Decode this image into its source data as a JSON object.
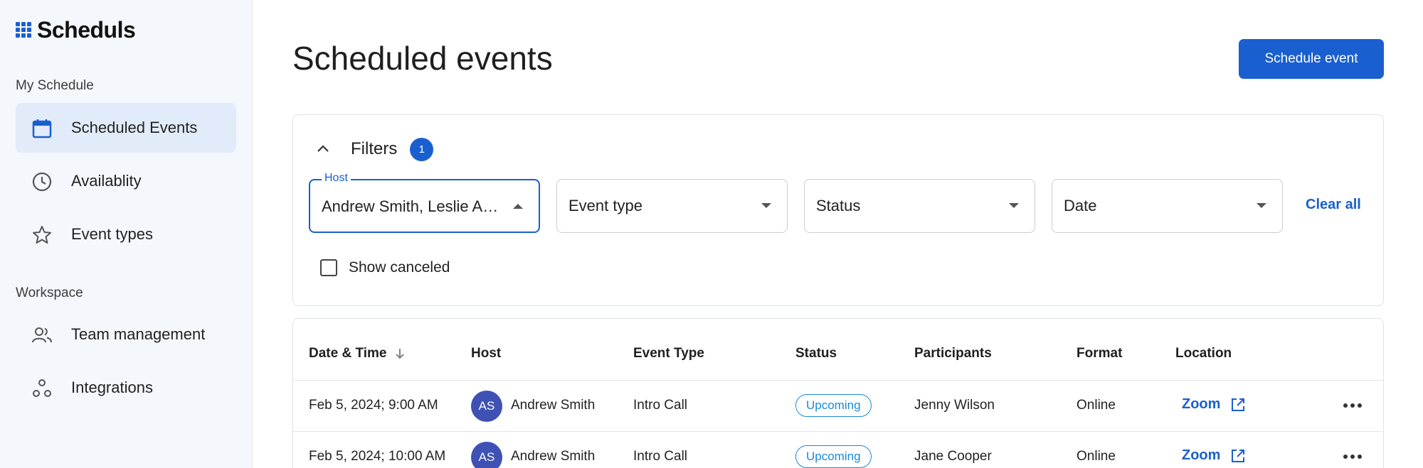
{
  "app": {
    "name": "Scheduls"
  },
  "sidebar": {
    "section_my": "My Schedule",
    "section_workspace": "Workspace",
    "items": [
      {
        "label": "Scheduled Events",
        "icon": "calendar-icon",
        "active": true
      },
      {
        "label": "Availablity",
        "icon": "clock-icon",
        "active": false
      },
      {
        "label": "Event types",
        "icon": "star-icon",
        "active": false
      },
      {
        "label": "Team management",
        "icon": "people-icon",
        "active": false
      },
      {
        "label": "Integrations",
        "icon": "integrations-icon",
        "active": false
      }
    ]
  },
  "header": {
    "title": "Scheduled events",
    "primary_button": "Schedule event"
  },
  "filters": {
    "title": "Filters",
    "count": "1",
    "host_label": "Host",
    "host_value": "Andrew Smith, Leslie Alexander",
    "event_type_placeholder": "Event type",
    "status_placeholder": "Status",
    "date_placeholder": "Date",
    "clear_all": "Clear all",
    "show_canceled_label": "Show canceled"
  },
  "table": {
    "columns": [
      "Date & Time",
      "Host",
      "Event Type",
      "Status",
      "Participants",
      "Format",
      "Location"
    ],
    "rows": [
      {
        "datetime": "Feb 5, 2024; 9:00 AM",
        "host_initials": "AS",
        "host": "Andrew Smith",
        "event_type": "Intro Call",
        "status": "Upcoming",
        "participants": "Jenny Wilson",
        "format": "Online",
        "location": "Zoom"
      },
      {
        "datetime": "Feb 5, 2024; 10:00 AM",
        "host_initials": "AS",
        "host": "Andrew Smith",
        "event_type": "Intro Call",
        "status": "Upcoming",
        "participants": "Jane Cooper",
        "format": "Online",
        "location": "Zoom"
      }
    ]
  },
  "colors": {
    "accent": "#1a5fd0",
    "status_upcoming": "#1b8ad9",
    "avatar": "#3f51b5",
    "sidebar_bg": "#f4f7fc",
    "sidebar_active": "#e2ebf9"
  }
}
